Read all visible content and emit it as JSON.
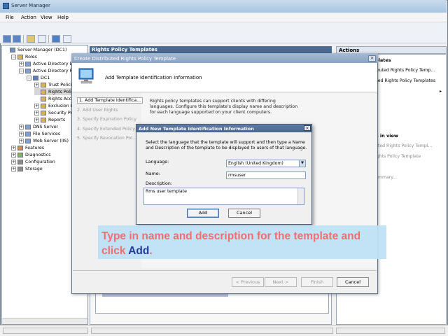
{
  "window": {
    "title": "Server Manager",
    "menu": [
      "File",
      "Action",
      "View",
      "Help"
    ]
  },
  "tree": {
    "items": [
      {
        "label": "Server Manager (DC1)",
        "depth": 0,
        "expander": ""
      },
      {
        "label": "Roles",
        "depth": 1,
        "expander": "−"
      },
      {
        "label": "Active Directory Do",
        "depth": 2,
        "expander": "+"
      },
      {
        "label": "Active Directory Rig",
        "depth": 2,
        "expander": "−"
      },
      {
        "label": "DC1",
        "depth": 3,
        "expander": "−"
      },
      {
        "label": "Trust Policie",
        "depth": 4,
        "expander": "+"
      },
      {
        "label": "Rights Polic",
        "depth": 4,
        "expander": ""
      },
      {
        "label": "Rights Acco",
        "depth": 4,
        "expander": ""
      },
      {
        "label": "Exclusion Po",
        "depth": 4,
        "expander": "+"
      },
      {
        "label": "Security Poli",
        "depth": 4,
        "expander": "+"
      },
      {
        "label": "Reports",
        "depth": 4,
        "expander": "+"
      },
      {
        "label": "DNS Server",
        "depth": 2,
        "expander": "+"
      },
      {
        "label": "File Services",
        "depth": 2,
        "expander": "+"
      },
      {
        "label": "Web Server (IIS)",
        "depth": 2,
        "expander": "+"
      },
      {
        "label": "Features",
        "depth": 1,
        "expander": "+"
      },
      {
        "label": "Diagnostics",
        "depth": 1,
        "expander": "+"
      },
      {
        "label": "Configuration",
        "depth": 1,
        "expander": "+"
      },
      {
        "label": "Storage",
        "depth": 1,
        "expander": "+"
      }
    ]
  },
  "center": {
    "header": "Rights Policy Templates"
  },
  "actions": {
    "header": "Actions",
    "section1": "plates",
    "items1": [
      "ibuted Rights Policy Temp...",
      "ved Rights Policy Templates"
    ],
    "section2": "n in view",
    "items2": [
      "uted Rights Policy Templ...",
      "ights Policy Template",
      "ummary..."
    ]
  },
  "wizard": {
    "title": "Create Distributed Rights Policy Template",
    "banner": "Add Template Identification Information",
    "steps": [
      "1. Add Template Identifica...",
      "2. Add User Rights",
      "3. Specify Expiration Policy",
      "4. Specify Extended Policy",
      "5. Specify Revocation Pol..."
    ],
    "description": "Rights policy templates can support clients with differing languages. Configure this template's display name and description for each language supported on your client computers.",
    "buttons": {
      "previous": "< Previous",
      "next": "Next >",
      "finish": "Finish",
      "cancel": "Cancel"
    }
  },
  "add_dialog": {
    "title": "Add New Template Identification Information",
    "intro": "Select the language that the template will support and then type a Name and Description of the template to be displayed to users of that language.",
    "language_label": "Language:",
    "language_value": "English (United Kingdom)",
    "name_label": "Name:",
    "name_value": "rmsuser",
    "description_label": "Description:",
    "description_value": "Rms user template",
    "add_button": "Add",
    "cancel_button": "Cancel"
  },
  "callout": {
    "text": "Type in name and description for the template and click ",
    "highlight": "Add",
    "suffix": "."
  }
}
